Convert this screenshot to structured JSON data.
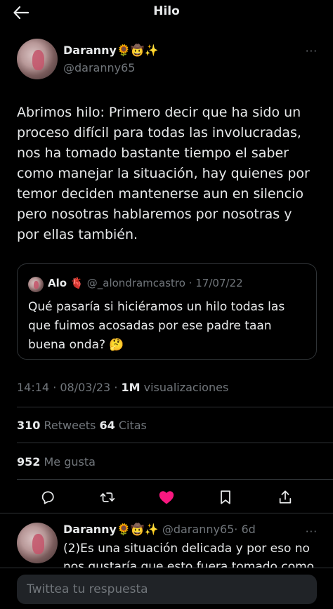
{
  "header": {
    "title": "Hilo",
    "back_icon": "arrow-left-icon"
  },
  "tweet": {
    "author_name": "Daranny🌻🤠✨",
    "handle": "@daranny65",
    "more_label": "···",
    "text": "Abrimos hilo: Primero decir que ha sido un\nproceso difícil para todas las involucradas,\nnos ha tomado bastante tiempo el saber\ncomo manejar la situación, hay quienes por\ntemor deciden mantenerse aun en silencio\npero nosotras hablaremos por nosotras y\npor ellas también.",
    "quote": {
      "author_name": "Alo 🫀",
      "handle": "@_alondramcastro",
      "date": "· 17/07/22",
      "text": "Qué pasaría si hiciéramos un hilo todas las\nque fuimos acosadas por ese padre taan\nbuena onda? 🤔"
    },
    "meta": {
      "time_date": "14:14 · 08/03/23 · ",
      "views_count": "1M",
      "views_label": " visualizaciones"
    },
    "stats": {
      "retweets_count": "310",
      "retweets_label": " Retweets ",
      "quotes_count": "64",
      "quotes_label": " Citas",
      "likes_count": "952",
      "likes_label": " Me gusta"
    },
    "actions": {
      "icons": [
        "reply-icon",
        "retweet-icon",
        "heart-icon",
        "bookmark-icon",
        "share-icon"
      ],
      "like_color": "#f91880"
    }
  },
  "reply": {
    "author_name": "Daranny🌻🤠✨",
    "handle": "@daranny65",
    "time": "· 6d",
    "more_label": "···",
    "text": "(2)Es una situación delicada y por eso no\nnos gustaría que esto fuera tomado como"
  },
  "composer": {
    "placeholder": "Twittea tu respuesta"
  },
  "colors": {
    "background": "#000000",
    "text": "#e7e9ea",
    "secondary": "#71767b",
    "border": "#2f3336"
  }
}
